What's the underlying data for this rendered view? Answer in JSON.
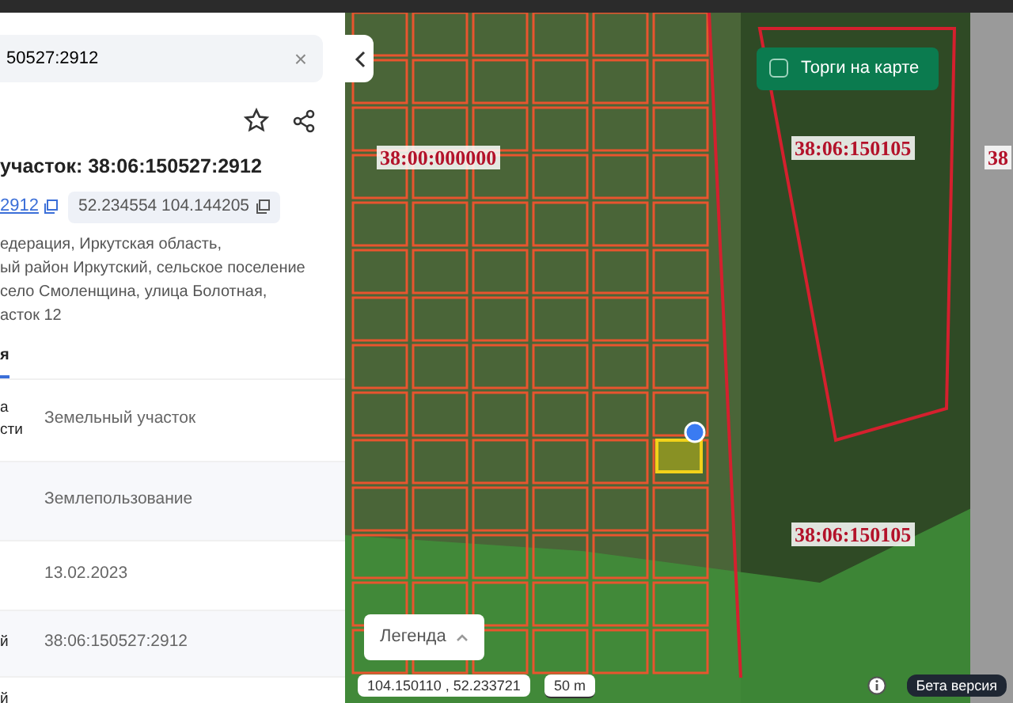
{
  "search": {
    "value": "50527:2912",
    "clear_button": "×"
  },
  "object": {
    "title": "участок: 38:06:150527:2912",
    "number_chip": "2912",
    "coords_chip": "52.234554 104.144205",
    "address": "едерация, Иркутская область,\nый район Иркутский, сельское поселение\nсело Смоленщина, улица Болотная,\nасток 12"
  },
  "tabs": [
    {
      "label": "я",
      "selected": true
    }
  ],
  "rows": [
    {
      "label": "а\nсти",
      "value": "Земельный участок"
    },
    {
      "label": "",
      "value": "Землепользование"
    },
    {
      "label": "",
      "value": "13.02.2023"
    },
    {
      "label": "й",
      "value": "38:06:150527:2912"
    },
    {
      "label": "й",
      "value": ""
    }
  ],
  "map": {
    "auction_toggle": {
      "label": "Торги на карте",
      "checked": false
    },
    "labels": [
      {
        "text": "38:00:000000"
      },
      {
        "text": "38:06:150105"
      },
      {
        "text": "38:06:150105"
      },
      {
        "text": "38"
      }
    ],
    "legend_button": "Легенда",
    "coordinates": "104.150110 , 52.233721",
    "scale": "50 m",
    "beta_badge": "Бета версия"
  }
}
